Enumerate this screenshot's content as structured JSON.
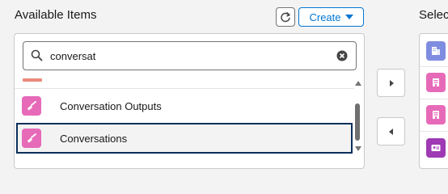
{
  "available": {
    "title": "Available Items",
    "create_label": "Create",
    "search_value": "conversat",
    "items": [
      {
        "label": "Conversation Outputs"
      },
      {
        "label": "Conversations"
      }
    ]
  },
  "selected": {
    "title": "Selec"
  },
  "colors": {
    "accent_blue": "#0176d3",
    "item_tile": "#e66ab8",
    "selected_border": "#0b2f5a"
  }
}
